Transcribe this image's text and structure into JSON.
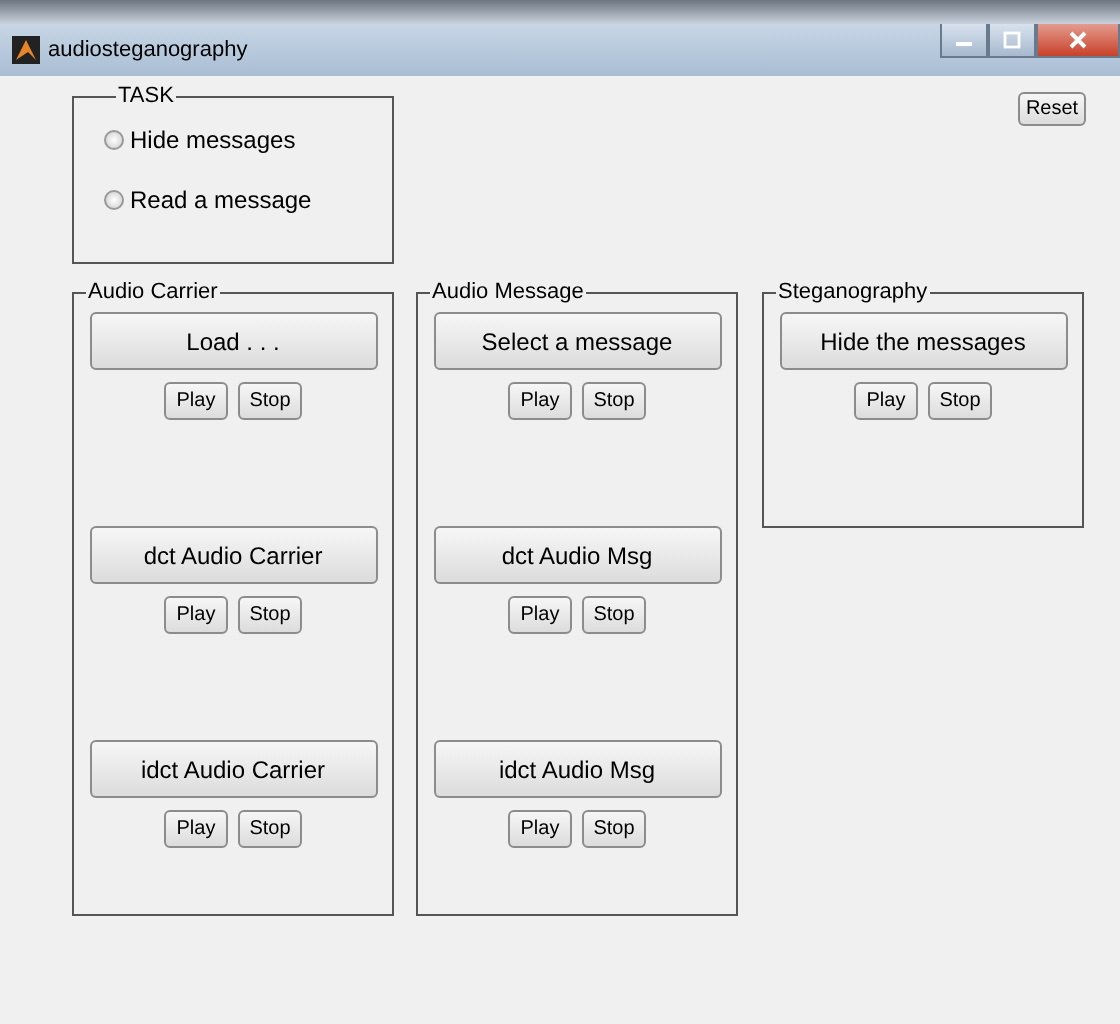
{
  "window": {
    "title": "audiosteganography"
  },
  "reset_button": "Reset",
  "task": {
    "title": "TASK",
    "options": [
      {
        "label": "Hide messages",
        "selected": false
      },
      {
        "label": "Read a message",
        "selected": false
      }
    ]
  },
  "panels": [
    {
      "title": "Audio Carrier",
      "groups": [
        {
          "action": "Load . . .",
          "play": "Play",
          "stop": "Stop"
        },
        {
          "action": "dct Audio Carrier",
          "play": "Play",
          "stop": "Stop"
        },
        {
          "action": "idct Audio Carrier",
          "play": "Play",
          "stop": "Stop"
        }
      ]
    },
    {
      "title": "Audio Message",
      "groups": [
        {
          "action": "Select a message",
          "play": "Play",
          "stop": "Stop"
        },
        {
          "action": "dct Audio Msg",
          "play": "Play",
          "stop": "Stop"
        },
        {
          "action": "idct Audio Msg",
          "play": "Play",
          "stop": "Stop"
        }
      ]
    },
    {
      "title": "Steganography",
      "groups": [
        {
          "action": "Hide the messages",
          "play": "Play",
          "stop": "Stop"
        }
      ]
    }
  ]
}
